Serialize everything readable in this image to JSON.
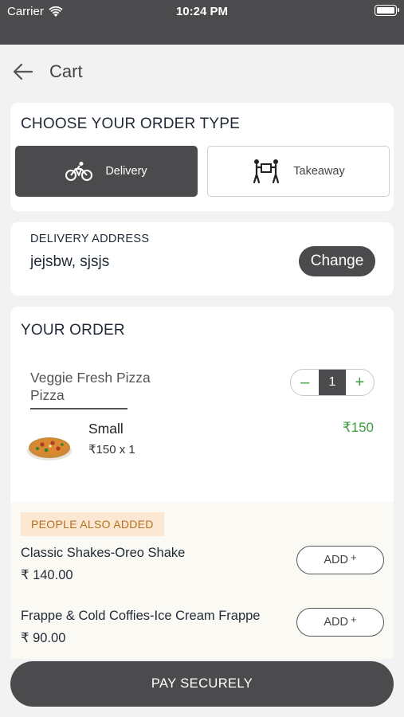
{
  "status_bar": {
    "carrier": "Carrier",
    "time": "10:24 PM"
  },
  "header": {
    "title": "Cart",
    "back_icon": "arrow-left-icon"
  },
  "order_type": {
    "title": "CHOOSE YOUR ORDER TYPE",
    "options": [
      {
        "label": "Delivery",
        "icon": "bicycle-icon",
        "selected": true
      },
      {
        "label": "Takeaway",
        "icon": "people-carrying-box-icon",
        "selected": false
      }
    ]
  },
  "delivery_address": {
    "label": "DELIVERY ADDRESS",
    "value": "jejsbw, sjsjs",
    "change_label": "Change"
  },
  "your_order": {
    "title": "YOUR ORDER",
    "items": [
      {
        "name": "Veggie Fresh Pizza Pizza",
        "quantity": "1",
        "variant": "Small",
        "unit_price": "₹150 x 1",
        "total": "₹150",
        "image_icon": "pizza-icon"
      }
    ]
  },
  "people_also_added": {
    "title": "PEOPLE ALSO ADDED",
    "items": [
      {
        "name": "Classic Shakes-Oreo Shake",
        "price": "₹ 140.00",
        "add_label": "ADD",
        "add_suffix": "+"
      },
      {
        "name": "Frappe & Cold Coffies-Ice Cream Frappe",
        "price": "₹ 90.00",
        "add_label": "ADD",
        "add_suffix": "+"
      }
    ]
  },
  "pay_button": {
    "label": "PAY SECURELY"
  },
  "colors": {
    "dark": "#4b4b4d",
    "accent_green": "#3d9b3d",
    "badge_bg": "#fbe7d2",
    "badge_text": "#b5711f"
  }
}
